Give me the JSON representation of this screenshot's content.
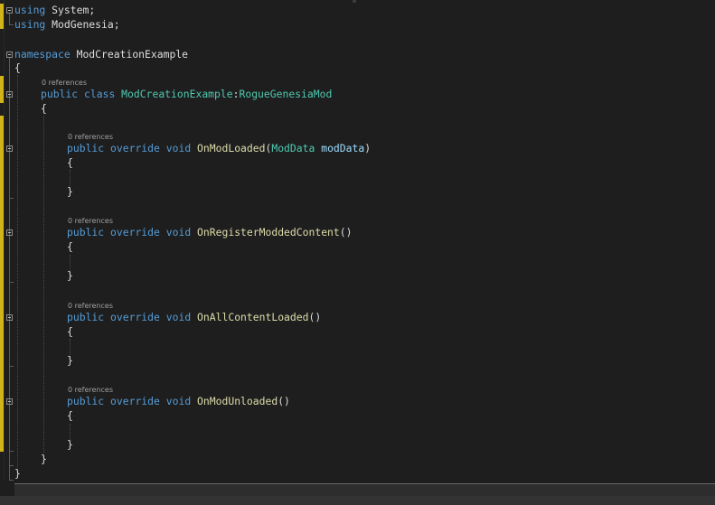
{
  "using1": {
    "kw": "using",
    "name": "System",
    "semi": ";"
  },
  "using2": {
    "kw": "using",
    "name": "ModGenesia",
    "semi": ";"
  },
  "ns": {
    "kw": "namespace",
    "name": "ModCreationExample",
    "open": "{",
    "close": "}"
  },
  "cls": {
    "refs": "0 references",
    "kw1": "public",
    "kw2": "class",
    "name": "ModCreationExample",
    "colon": ":",
    "base": "RogueGenesiaMod",
    "open": "{",
    "close": "}"
  },
  "methods": [
    {
      "refs": "0 references",
      "kw1": "public",
      "kw2": "override",
      "kw3": "void",
      "name": "OnModLoaded",
      "paren_open": "(",
      "ptype": "ModData",
      "pname": "modData",
      "paren_close": ")",
      "open": "{",
      "close": "}"
    },
    {
      "refs": "0 references",
      "kw1": "public",
      "kw2": "override",
      "kw3": "void",
      "name": "OnRegisterModdedContent",
      "parens": "()",
      "open": "{",
      "close": "}"
    },
    {
      "refs": "0 references",
      "kw1": "public",
      "kw2": "override",
      "kw3": "void",
      "name": "OnAllContentLoaded",
      "parens": "()",
      "open": "{",
      "close": "}"
    },
    {
      "refs": "0 references",
      "kw1": "public",
      "kw2": "override",
      "kw3": "void",
      "name": "OnModUnloaded",
      "parens": "()",
      "open": "{",
      "close": "}"
    }
  ],
  "colors": {
    "keyword": "#569cd6",
    "type": "#4ec9b0",
    "method": "#dcdcaa",
    "param": "#9cdcfe",
    "text": "#dcdcdc",
    "change_bar": "#d2b418"
  },
  "icons": [
    "collapse-icon"
  ]
}
